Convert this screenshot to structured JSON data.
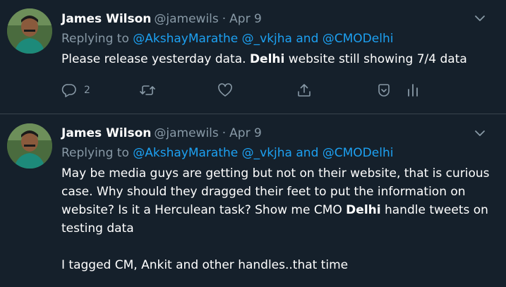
{
  "tweets": [
    {
      "name": "James Wilson",
      "handle": "@jamewils",
      "dot": "·",
      "date": "Apr 9",
      "replying_prefix": "Replying to ",
      "mention1": "@AkshayMarathe",
      "mention2": "@_vkjha",
      "and_word": "and",
      "mention3": "@CMODelhi",
      "body": {
        "part1": "Please release yesterday data. ",
        "bold1": "Delhi",
        "part2": " website still showing 7/4 data"
      },
      "reply_count": "2"
    },
    {
      "name": "James Wilson",
      "handle": "@jamewils",
      "dot": "·",
      "date": "Apr 9",
      "replying_prefix": "Replying to ",
      "mention1": "@AkshayMarathe",
      "mention2": "@_vkjha",
      "and_word": "and",
      "mention3": "@CMODelhi",
      "body": {
        "part1": "May be media guys are getting but not on their website, that is curious case. Why should they dragged their feet to put the information on website? Is it a Herculean task? Show me CMO ",
        "bold1": "Delhi",
        "part2": " handle tweets on testing data",
        "para2": "I tagged CM, Ankit and other handles..that time"
      }
    }
  ],
  "icons": {
    "reply": "reply-icon",
    "retweet": "retweet-icon",
    "like": "heart-icon",
    "share": "share-icon",
    "save": "save-icon",
    "analytics": "analytics-icon",
    "more": "chevron-down-icon"
  },
  "colors": {
    "background": "#15202b",
    "divider": "#38444d",
    "text": "#ffffff",
    "muted": "#8899a6",
    "link": "#1da1f2"
  }
}
